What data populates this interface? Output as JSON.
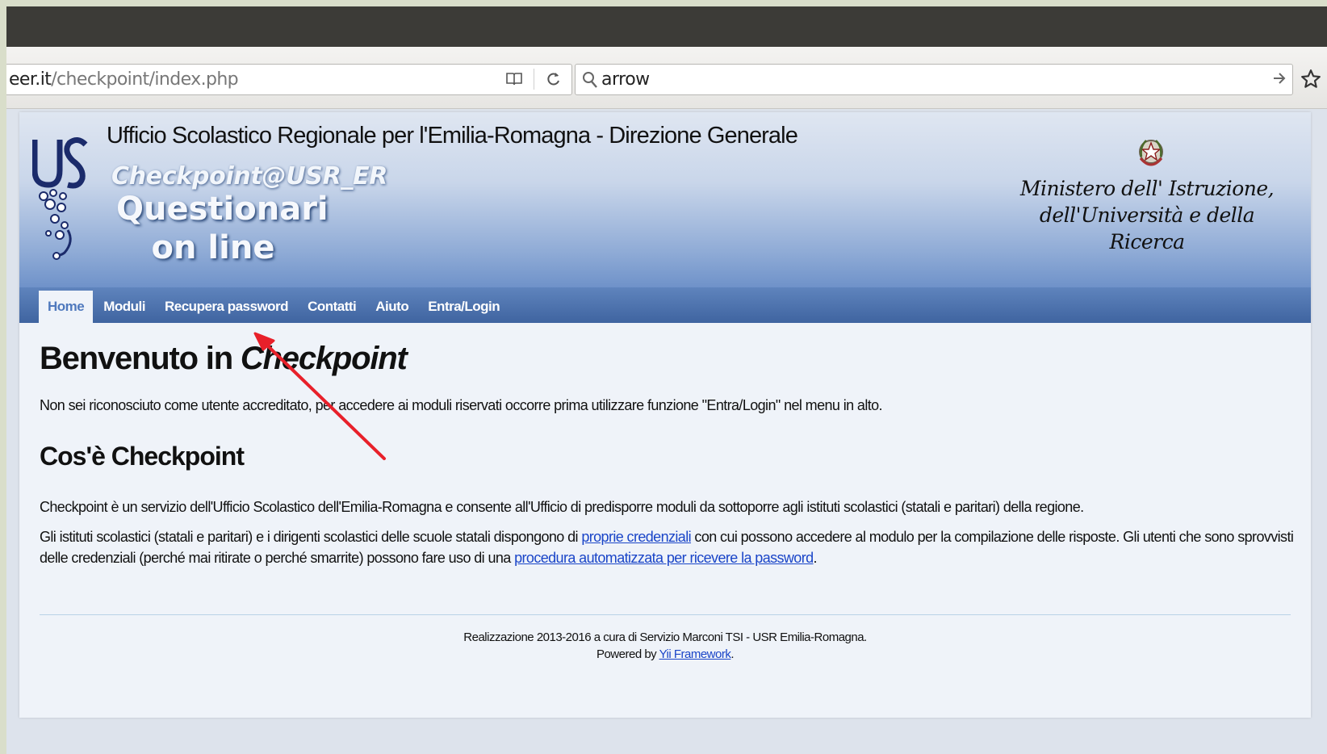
{
  "browser": {
    "url_host": "eer.it",
    "url_path": "/checkpoint/index.php",
    "search_query": "arrow"
  },
  "header": {
    "org_title": "Ufficio Scolastico Regionale per l'Emilia-Romagna - Direzione Generale",
    "app_title": "Checkpoint@USR_ER",
    "subtitle_line1": "Questionari",
    "subtitle_line2": "on line",
    "ministry_line1": "Ministero dell' Istruzione,",
    "ministry_line2": "dell'Università e della Ricerca"
  },
  "nav": {
    "items": [
      {
        "label": "Home",
        "active": true
      },
      {
        "label": "Moduli"
      },
      {
        "label": "Recupera password"
      },
      {
        "label": "Contatti"
      },
      {
        "label": "Aiuto"
      },
      {
        "label": "Entra/Login"
      }
    ]
  },
  "main": {
    "welcome_prefix": "Benvenuto in ",
    "welcome_em": "Checkpoint",
    "notice": "Non sei riconosciuto come utente accreditato, per accedere ai moduli riservati occorre prima utilizzare funzione \"Entra/Login\" nel menu in alto.",
    "about_title": "Cos'è Checkpoint",
    "about_p1": "Checkpoint è un servizio dell'Ufficio Scolastico dell'Emilia-Romagna e consente all'Ufficio di predisporre moduli da sottoporre agli istituti scolastici (statali e paritari) della regione.",
    "about_p2_a": "Gli istituti scolastici (statali e paritari) e i dirigenti scolastici delle scuole statali dispongono di ",
    "about_p2_link1": "proprie credenziali",
    "about_p2_b": " con cui possono accedere al modulo per la compilazione delle risposte. Gli utenti che sono sprovvisti delle credenziali (perché mai ritirate o perché smarrite) possono fare uso di una ",
    "about_p2_link2": "procedura automatizzata per ricevere la password",
    "about_p2_c": "."
  },
  "footer": {
    "line1": "Realizzazione 2013-2016 a cura di Servizio Marconi TSI - USR Emilia-Romagna.",
    "powered_prefix": "Powered by ",
    "powered_link": "Yii Framework",
    "powered_suffix": "."
  },
  "colors": {
    "nav_bg": "#4a6fab",
    "link": "#1a45c8",
    "annotation_arrow": "#e8202a"
  },
  "icons": [
    "reader-mode-icon",
    "reload-icon",
    "search-icon",
    "go-arrow-icon",
    "bookmark-star-icon",
    "usr-logo-icon",
    "republic-emblem-icon",
    "red-annotation-arrow-icon"
  ]
}
